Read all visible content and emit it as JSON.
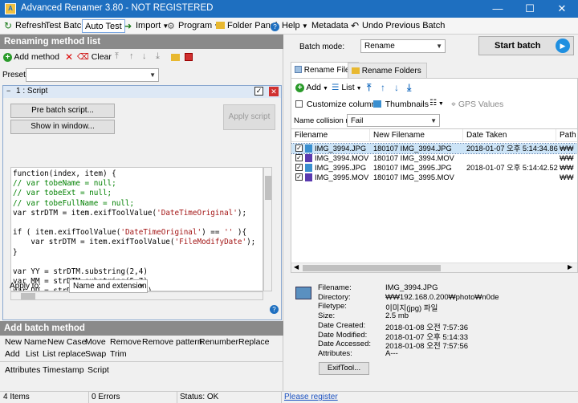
{
  "window": {
    "title": "Advanced Renamer 3.80 - NOT REGISTERED",
    "minimize": "—",
    "maximize": "☐",
    "close": "✕"
  },
  "toolbar": {
    "refresh": "Refresh",
    "test_batch": "Test Batch",
    "auto_test": "Auto Test",
    "import": "Import",
    "program": "Program",
    "folder_panel": "Folder Panel",
    "help": "Help",
    "metadata": "Metadata",
    "undo": "Undo Previous Batch"
  },
  "renaming": {
    "header": "Renaming method list",
    "add_method": "Add method",
    "clear": "Clear",
    "presets_label": "Presets:",
    "presets_value": "",
    "method_title": "1 : Script",
    "pre_batch": "Pre batch script...",
    "show_window": "Show in window...",
    "apply_script": "Apply script",
    "apply_to_label": "Apply to:",
    "apply_to_value": "Name and extension",
    "help_glyph": "?"
  },
  "code_lines": [
    {
      "t": "function(index, item) {",
      "c": ""
    },
    {
      "t": "// var tobeName = null;",
      "c": "cm"
    },
    {
      "t": "// var tobeExt = null;",
      "c": "cm"
    },
    {
      "t": "// var tobeFullName = null;",
      "c": "cm"
    },
    {
      "t": "var strDTM = item.exifToolValue('DateTimeOriginal');",
      "c": ""
    },
    {
      "t": "",
      "c": ""
    },
    {
      "t": "if ( item.exifToolValue('DateTimeOriginal') == '' ){",
      "c": ""
    },
    {
      "t": "    var strDTM = item.exifToolValue('FileModifyDate');",
      "c": ""
    },
    {
      "t": "}",
      "c": ""
    },
    {
      "t": "",
      "c": ""
    },
    {
      "t": "var YY = strDTM.substring(2,4)",
      "c": ""
    },
    {
      "t": "var MM = strDTM.substring(5,7)",
      "c": ""
    },
    {
      "t": "var DD = strDTM.substring(8,10)",
      "c": ""
    }
  ],
  "batch_methods": {
    "header": "Add batch method",
    "row1": [
      "New Name",
      "New Case",
      "Move",
      "Remove",
      "Remove pattern",
      "Renumber",
      "Replace"
    ],
    "row2": [
      "Add",
      "List",
      "List replace",
      "Swap",
      "Trim"
    ],
    "row3": [
      "Attributes",
      "Timestamp",
      "Script"
    ]
  },
  "right": {
    "batch_mode_label": "Batch mode:",
    "batch_mode_value": "Rename",
    "start_batch": "Start batch",
    "tab_files": "Rename Files",
    "tab_folders": "Rename Folders",
    "add": "Add",
    "list": "List",
    "customize_columns": "Customize columns",
    "thumbnails": "Thumbnails",
    "gps_values": "GPS Values",
    "collision_label": "Name collision rule:",
    "collision_value": "Fail",
    "columns": [
      "Filename",
      "New Filename",
      "Date Taken",
      "Path"
    ],
    "files": [
      {
        "name": "IMG_3994.JPG",
        "new": "180107 IMG_3994.JPG",
        "date": "2018-01-07 오후 5:14:34.86",
        "path": "₩₩",
        "type": "jpg",
        "selected": true
      },
      {
        "name": "IMG_3994.MOV",
        "new": "180107 IMG_3994.MOV",
        "date": "",
        "path": "₩₩",
        "type": "mov",
        "selected": false
      },
      {
        "name": "IMG_3995.JPG",
        "new": "180107 IMG_3995.JPG",
        "date": "2018-01-07 오후 5:14:42.52",
        "path": "₩₩",
        "type": "jpg",
        "selected": false
      },
      {
        "name": "IMG_3995.MOV",
        "new": "180107 IMG_3995.MOV",
        "date": "",
        "path": "₩₩",
        "type": "mov",
        "selected": false
      }
    ],
    "info": {
      "filename_label": "Filename:",
      "filename": "IMG_3994.JPG",
      "directory_label": "Directory:",
      "directory": "₩₩192.168.0.200₩photo₩n0de",
      "filetype_label": "Filetype:",
      "filetype": "이미지(jpg) 파일",
      "size_label": "Size:",
      "size": "2.5 mb",
      "created_label": "Date Created:",
      "created": "2018-01-08 오전 7:57:36",
      "modified_label": "Date Modified:",
      "modified": "2018-01-07 오후 5:14:33",
      "accessed_label": "Date Accessed:",
      "accessed": "2018-01-08 오전 7:57:56",
      "attributes_label": "Attributes:",
      "attributes": "A---",
      "exiftool": "ExifTool..."
    }
  },
  "status": {
    "items": "4 Items",
    "errors": "0 Errors",
    "status": "Status: OK",
    "register": "Please register"
  },
  "colors": {
    "titlebar": "#1e6fc0",
    "accent": "#1e6fc0",
    "section": "#8a8a8a",
    "selected_row": "#cce4f7"
  }
}
